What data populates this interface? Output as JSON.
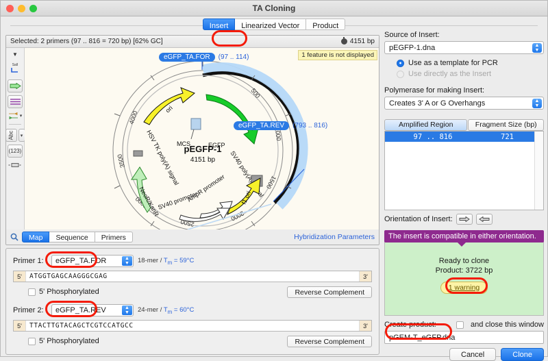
{
  "window": {
    "title": "TA Cloning"
  },
  "tabs": [
    {
      "label": "Insert",
      "selected": true
    },
    {
      "label": "Linearized Vector",
      "selected": false
    },
    {
      "label": "Product",
      "selected": false
    }
  ],
  "map_panel": {
    "selection_text": "Selected:  2 primers  (97 .. 816  =  720 bp)    [62% GC]",
    "length_text": "4151 bp",
    "not_displayed_note": "1 feature is not displayed",
    "toolbar_icons": [
      "filter-icon",
      "enzyme-sall-icon",
      "feature-arrow-icon",
      "translation-icon",
      "primer-pair-icon",
      "abc-text-icon",
      "numbers-icon",
      "ruler-icon"
    ],
    "view_tabs": [
      {
        "label": "Map",
        "selected": true
      },
      {
        "label": "Sequence",
        "selected": false
      },
      {
        "label": "Primers",
        "selected": false
      }
    ],
    "hybridization_link": "Hybridization Parameters",
    "plasmid": {
      "name": "pEGFP-1",
      "size": "4151 bp",
      "tick_labels": [
        "500",
        "1000",
        "1500",
        "2000",
        "2500",
        "3000",
        "3500",
        "4000"
      ],
      "features": [
        {
          "label": "MCS"
        },
        {
          "label": "EGFP"
        },
        {
          "label": "SV40 poly(A) signal"
        },
        {
          "label": "f1 ori"
        },
        {
          "label": "AmpR promoter"
        },
        {
          "label": "SV40 promoter"
        },
        {
          "label": "NeoR/KanR"
        },
        {
          "label": "HSV TK poly(A) signal"
        },
        {
          "label": "ori"
        }
      ],
      "primer_callouts": [
        {
          "name": "eGFP_TA.FOR",
          "range": "(97 .. 114)"
        },
        {
          "name": "eGFP_TA.REV",
          "range": "(793 .. 816)"
        }
      ]
    }
  },
  "primers": [
    {
      "row_label": "Primer 1:",
      "name": "eGFP_TA.FOR",
      "length": "18-mer",
      "tm_label": "T",
      "tm_sub": "m",
      "tm_value": "=  59°C",
      "five_prime": "5'",
      "three_prime": "3'",
      "sequence": "ATGGTGAGCAAGGGCGAG",
      "phospho_label": "5' Phosphorylated",
      "phospho_checked": false,
      "revcomp_label": "Reverse Complement",
      "highlighted": true
    },
    {
      "row_label": "Primer 2:",
      "name": "eGFP_TA.REV",
      "length": "24-mer",
      "tm_label": "T",
      "tm_sub": "m",
      "tm_value": "=  60°C",
      "five_prime": "5'",
      "three_prime": "3'",
      "sequence": "TTACTTGTACAGCTCGTCCATGCC",
      "phospho_label": "5' Phosphorylated",
      "phospho_checked": false,
      "revcomp_label": "Reverse Complement",
      "highlighted": true
    }
  ],
  "right": {
    "source_label": "Source of Insert:",
    "source_value": "pEGFP-1.dna",
    "radio_template": "Use as a template for PCR",
    "radio_direct": "Use directly as the Insert",
    "polymerase_label": "Polymerase for making Insert:",
    "polymerase_value": "Creates 3' A or G Overhangs",
    "table": {
      "headers": [
        "Amplified Region",
        "Fragment Size (bp)"
      ],
      "rows": [
        {
          "region": "97 .. 816",
          "size": "721"
        }
      ]
    },
    "orientation_label": "Orientation of Insert:",
    "orientation_buttons": [
      "forward-orientation",
      "reverse-orientation"
    ],
    "tooltip": "The insert is compatible in either orientation.",
    "status": {
      "ready": "Ready to clone",
      "product": "Product:  3722 bp",
      "warning": "1 warning"
    },
    "create_product_label": "Create product:",
    "and_close_label": "and close this window",
    "and_close_checked": false,
    "product_name": "pGEM-T_eGFP.dna",
    "cancel_label": "Cancel",
    "clone_label": "Clone"
  },
  "colors": {
    "accent_blue": "#1a72e8",
    "highlight_red": "#f41b09",
    "tooltip_purple": "#8e2a8e",
    "ready_green": "#cdf0c9",
    "warning_yellow": "#fcf3a6",
    "map_bg": "#fdfaf1"
  }
}
